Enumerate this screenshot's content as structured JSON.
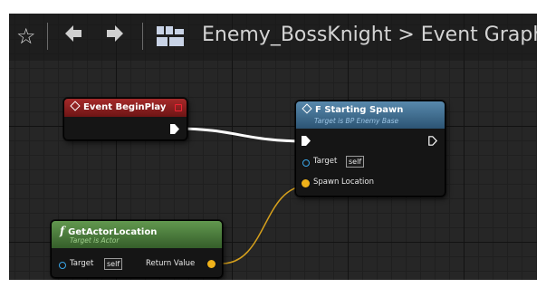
{
  "toolbar": {
    "icons": [
      "star-icon",
      "back-arrow-icon",
      "forward-arrow-icon",
      "blueprint-icon"
    ],
    "breadcrumb_root": "Enemy_BossKnight",
    "breadcrumb_separator": ">",
    "breadcrumb_current": "Event Graph"
  },
  "nodes": {
    "begin_play": {
      "title": "Event BeginPlay",
      "icon": "event-diamond-icon",
      "header_color": "#8c1f1f"
    },
    "starting_spawn": {
      "title": "F Starting Spawn",
      "subtitle": "Target is BP Enemy Base",
      "icon": "function-diamond-icon",
      "header_color": "#3f6f93",
      "pins": {
        "target_label": "Target",
        "target_default": "self",
        "spawn_label": "Spawn Location"
      }
    },
    "get_actor_location": {
      "title": "GetActorLocation",
      "subtitle": "Target is Actor",
      "icon": "function-f-icon",
      "header_color": "#4f7e40",
      "pins": {
        "target_label": "Target",
        "target_default": "self",
        "return_label": "Return Value"
      }
    }
  },
  "wires": {
    "exec_color": "#ffffff",
    "vector_color": "#d6a01c",
    "object_pin_color": "#3aa6e8"
  }
}
